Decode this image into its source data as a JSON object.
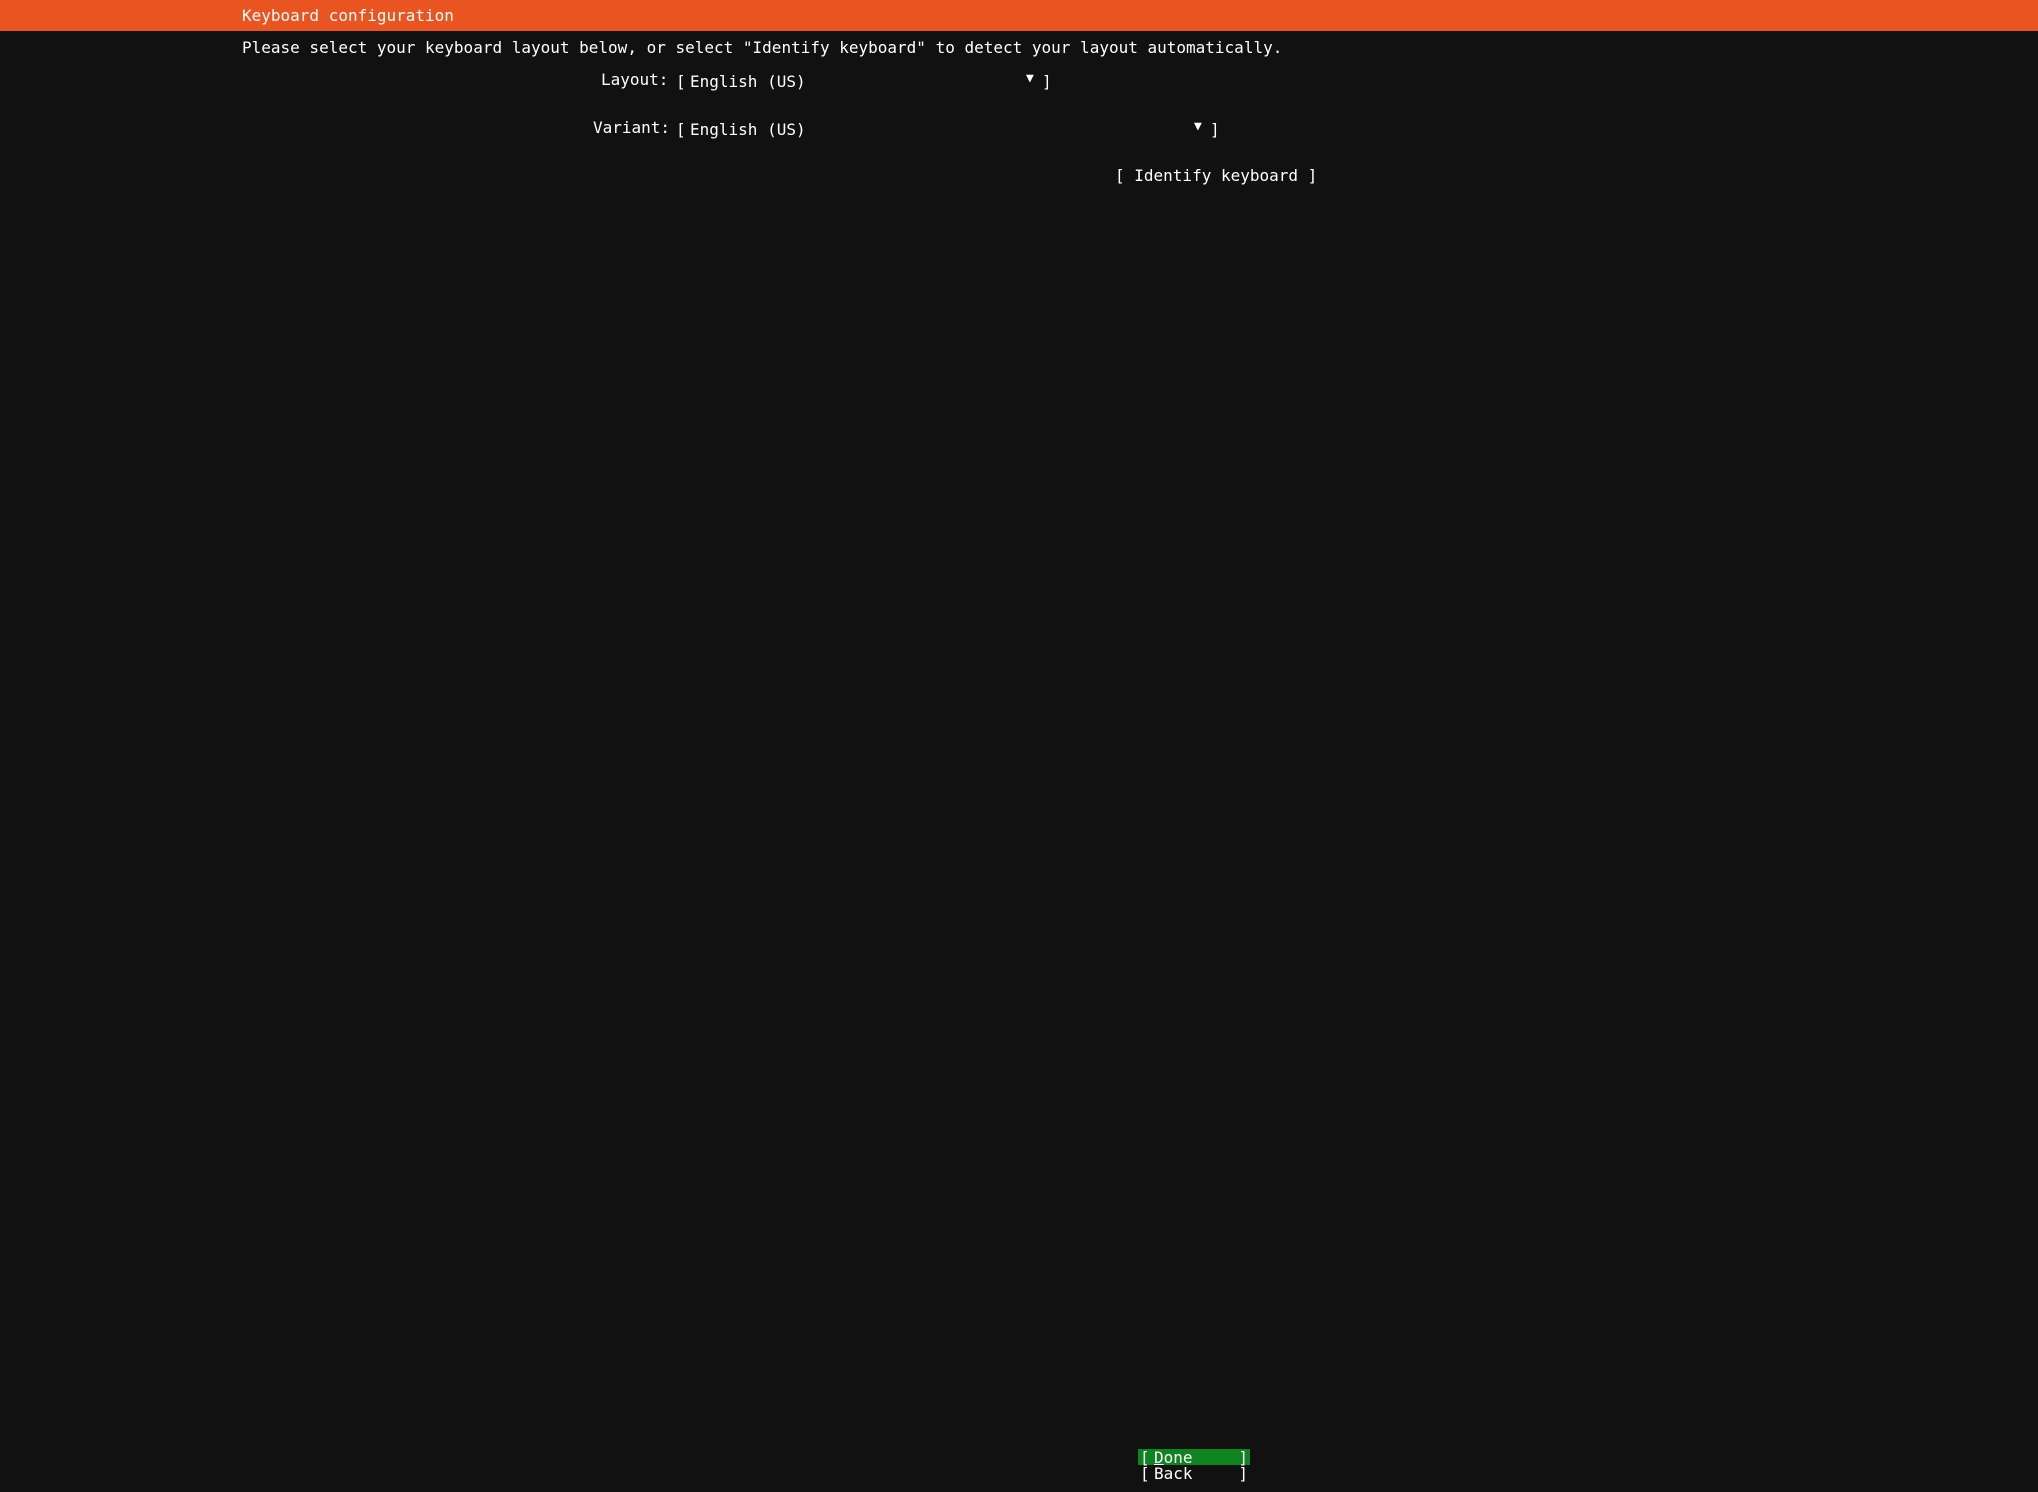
{
  "header": {
    "title": "Keyboard configuration"
  },
  "instructions": "Please select your keyboard layout below, or select \"Identify keyboard\" to detect your layout automatically.",
  "form": {
    "layout": {
      "label": "Layout:",
      "bracket_open": "[",
      "value": "English (US)",
      "arrow": "▼",
      "bracket_close": "]"
    },
    "variant": {
      "label": "Variant:",
      "bracket_open": "[",
      "value": "English (US)",
      "arrow": "▼",
      "bracket_close": "]"
    },
    "identify_button_label": "[ Identify keyboard ]"
  },
  "buttons": {
    "done": {
      "bracket_open": "[",
      "accel": "D",
      "rest": "one",
      "bracket_close": "]"
    },
    "back": {
      "bracket_open": "[",
      "label": "Back",
      "bracket_close": "]"
    }
  },
  "colors": {
    "header_bg": "#e95420",
    "background": "#111111",
    "focus_bg": "#0e8420",
    "text": "#ffffff"
  }
}
